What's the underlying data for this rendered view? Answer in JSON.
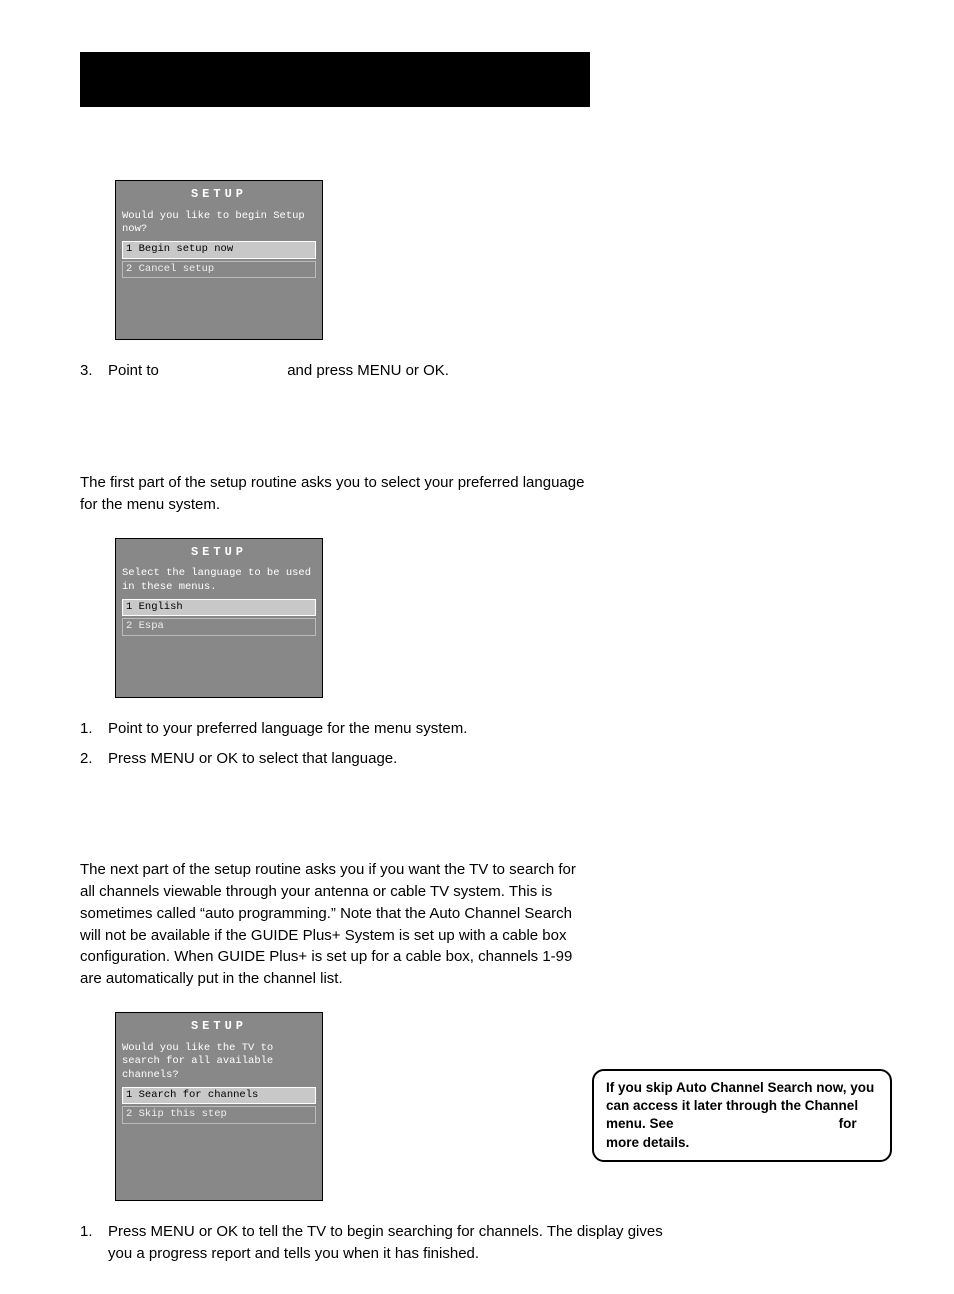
{
  "screen1": {
    "title": "SETUP",
    "prompt": "Would you like to begin Setup now?",
    "opt1": "1 Begin setup now",
    "opt2": "2 Cancel setup"
  },
  "step3": {
    "num": "3.",
    "pre": "Point to ",
    "post": " and press MENU or OK."
  },
  "lang_intro": "The first part of the setup routine asks you to select your preferred language for the menu system.",
  "screen2": {
    "title": "SETUP",
    "prompt": "Select the language to be used in these menus.",
    "opt1": "1 English",
    "opt2": "2 Espa"
  },
  "lang_step1": {
    "num": "1.",
    "text": "Point to your preferred language for the menu system."
  },
  "lang_step2": {
    "num": "2.",
    "text": "Press MENU or OK to select that language."
  },
  "chan_intro": "The next part of the setup routine asks you if you want the TV to search for all channels viewable through your antenna or cable TV system. This is sometimes called “auto programming.” Note that the Auto Channel Search will not be available if the GUIDE Plus+ System is set up with a cable box configuration. When GUIDE Plus+ is set up for a cable box, channels 1-99 are automatically put in the channel list.",
  "screen3": {
    "title": "SETUP",
    "prompt": "Would you like the TV to search for all available channels?",
    "opt1": "1 Search for channels",
    "opt2": "2 Skip this step"
  },
  "chan_step1": {
    "num": "1.",
    "text": "Press MENU or OK to tell the TV to begin searching for channels. The display gives you a progress report and tells you when it has finished."
  },
  "tip": {
    "line1": "If you skip Auto Channel Search now, you can access it later through the Channel menu. See",
    "line2": "for more details."
  }
}
